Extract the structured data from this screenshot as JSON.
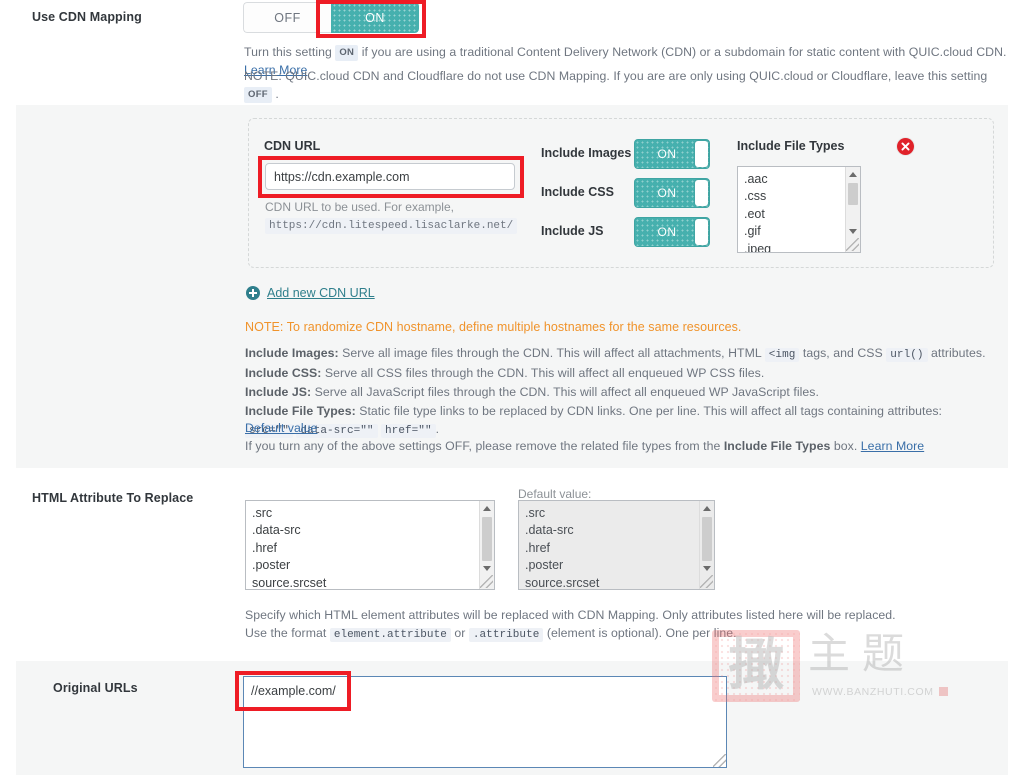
{
  "theme": {
    "accent": "#46b0ae",
    "link": "#3a6fa8",
    "teal_link": "#2f7f8c",
    "note_orange": "#f0932b",
    "danger": "#e0222a",
    "highlight_box": "#ee1c25",
    "band_bg": "#f5f6f6"
  },
  "cdn_mapping_row": {
    "label": "Use CDN Mapping",
    "toggle": {
      "off_label": "OFF",
      "on_label": "ON",
      "selected": "ON"
    },
    "desc_line1_a": "Turn this setting",
    "desc_line1_pill": "ON",
    "desc_line1_b": "if you are using a traditional Content Delivery Network (CDN) or a subdomain for static content with QUIC.cloud CDN.",
    "desc_line1_link": "Learn More",
    "desc_line2_a": "NOTE: QUIC.cloud CDN and Cloudflare do not use CDN Mapping. If you are are only using QUIC.cloud or Cloudflare, leave this setting",
    "desc_line2_pill": "OFF",
    "desc_line2_b": "."
  },
  "cdn_card": {
    "cdn_url": {
      "title": "CDN URL",
      "value": "https://cdn.example.com",
      "placeholder": "https://cdn.example.com",
      "caption": "CDN URL to be used. For example,",
      "example": "https://cdn.litespeed.lisaclarke.net/"
    },
    "switches": [
      {
        "label": "Include Images",
        "state": "ON"
      },
      {
        "label": "Include CSS",
        "state": "ON"
      },
      {
        "label": "Include JS",
        "state": "ON"
      }
    ],
    "file_types": {
      "title": "Include File Types",
      "items": [
        ".aac",
        ".css",
        ".eot",
        ".gif",
        ".jpeg"
      ]
    },
    "delete_icon": "close-circle-icon",
    "add_new": {
      "icon": "plus-circle-icon",
      "label": "Add new CDN URL"
    },
    "note": "NOTE: To randomize CDN hostname, define multiple hostnames for the same resources.",
    "help": {
      "images_bold": "Include Images:",
      "images_text_a": " Serve all image files through the CDN. This will affect all attachments, HTML ",
      "images_code1": "<img",
      "images_text_b": " tags, and CSS ",
      "images_code2": "url()",
      "images_text_c": " attributes.",
      "css_bold": "Include CSS:",
      "css_text": " Serve all CSS files through the CDN. This will affect all enqueued WP CSS files.",
      "js_bold": "Include JS:",
      "js_text": " Serve all JavaScript files through the CDN. This will affect all enqueued WP JavaScript files.",
      "ft_bold": "Include File Types:",
      "ft_text_a": " Static file type links to be replaced by CDN links. One per line. This will affect all tags containing attributes: ",
      "ft_code1": "src=\"\"",
      "ft_code2": "data-src=\"\"",
      "ft_code3": "href=\"\"",
      "ft_text_b": ".",
      "default_value_link": "Default value",
      "off_text_a": "If you turn any of the above settings OFF, please remove the related file types from the ",
      "off_text_bold": "Include File Types",
      "off_text_b": " box.",
      "off_link": "Learn More"
    }
  },
  "html_attr_row": {
    "label": "HTML Attribute To Replace",
    "editable_list": [
      ".src",
      ".data-src",
      ".href",
      ".poster",
      "source.srcset"
    ],
    "default_caption": "Default value:",
    "default_list": [
      ".src",
      ".data-src",
      ".href",
      ".poster",
      "source.srcset"
    ],
    "desc_line1": "Specify which HTML element attributes will be replaced with CDN Mapping. Only attributes listed here will be replaced.",
    "desc_line2_a": "Use the format ",
    "desc_line2_code1": "element.attribute",
    "desc_line2_b": " or ",
    "desc_line2_code2": ".attribute",
    "desc_line2_c": " (element is optional). One per line."
  },
  "original_urls_row": {
    "label": "Original URLs",
    "value": "//example.com/",
    "placeholder": "//example.com/"
  },
  "watermark": {
    "seal_char": "撖",
    "text": "主题",
    "url": "WWW.BANZHUTI.COM"
  }
}
